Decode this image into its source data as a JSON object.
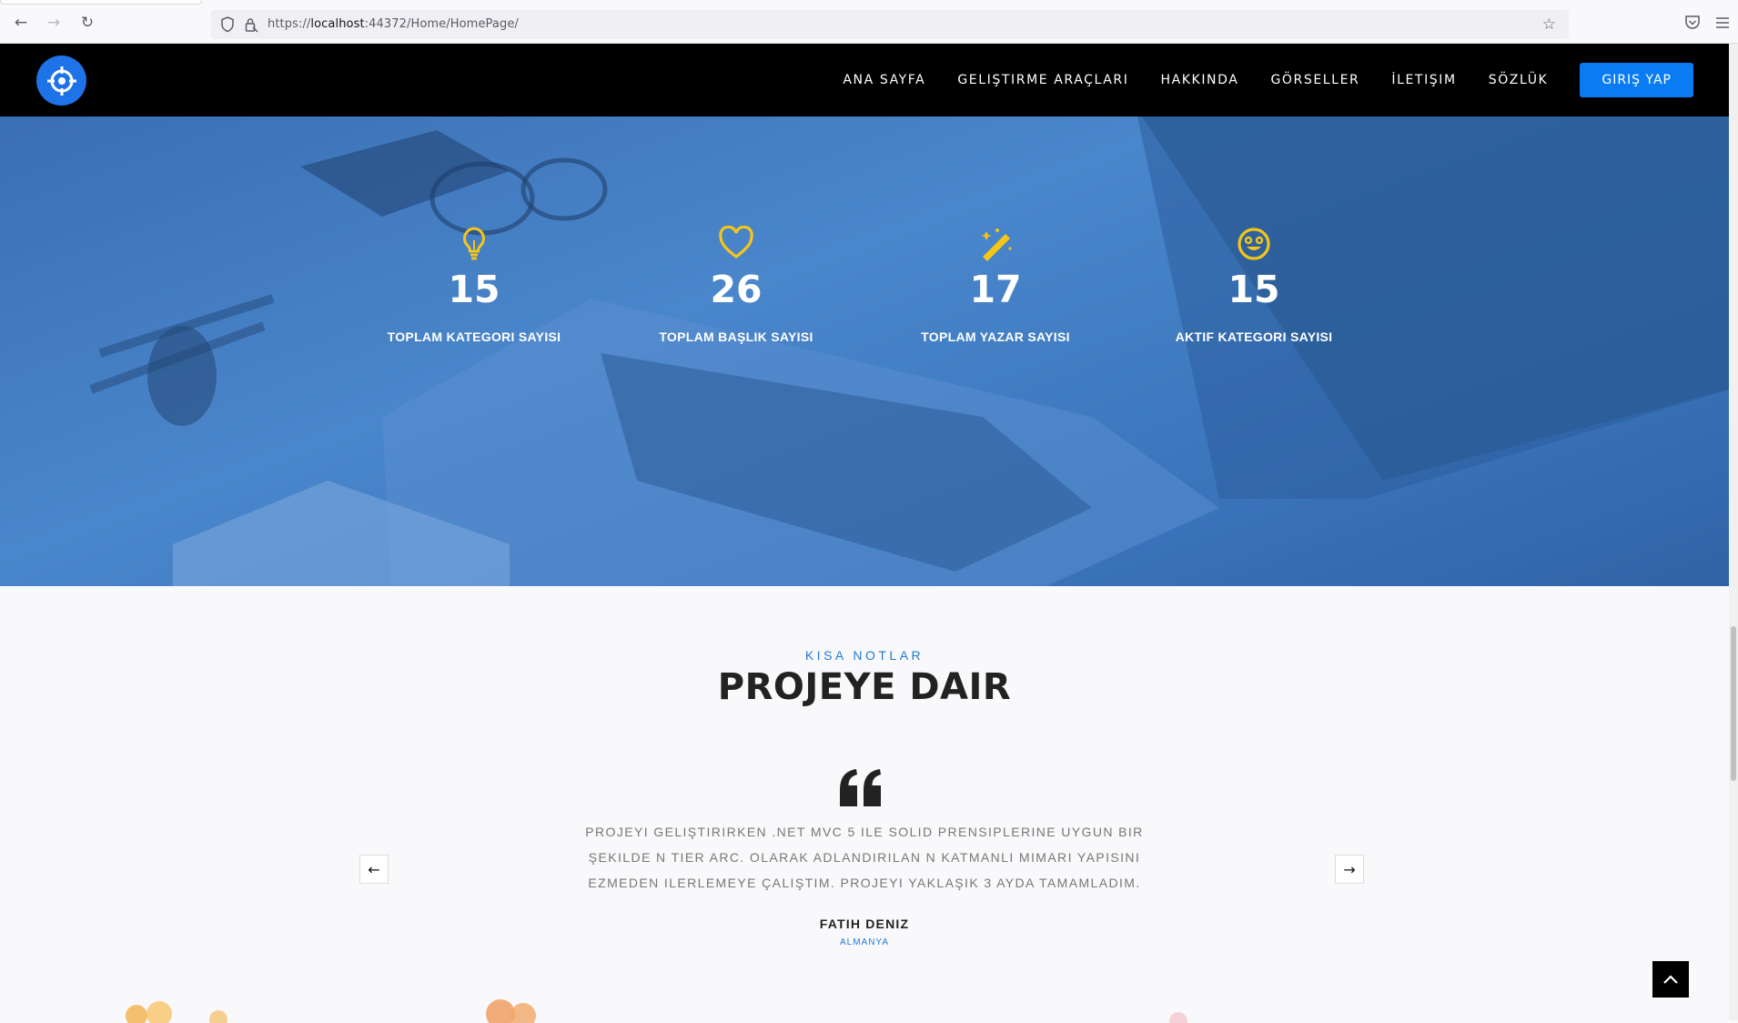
{
  "browser": {
    "url_prefix": "https://",
    "url_host": "localhost",
    "url_rest": ":44372/Home/HomePage/",
    "back_icon": "arrow-left-icon",
    "forward_icon": "arrow-right-icon",
    "reload_icon": "reload-icon"
  },
  "nav": {
    "items": [
      {
        "label": "ANA SAYFA"
      },
      {
        "label": "GELIŞTIRME ARAÇLARI"
      },
      {
        "label": "HAKKINDA"
      },
      {
        "label": "GÖRSELLER"
      },
      {
        "label": "İLETIŞIM"
      },
      {
        "label": "SÖZLÜK"
      }
    ],
    "login_label": "GIRIŞ YAP"
  },
  "stats": [
    {
      "icon": "lightbulb-icon",
      "value": "15",
      "label": "TOPLAM KATEGORI SAYISI"
    },
    {
      "icon": "heart-icon",
      "value": "26",
      "label": "TOPLAM BAŞLIK SAYISI"
    },
    {
      "icon": "magic-wand-icon",
      "value": "17",
      "label": "TOPLAM YAZAR SAYISI"
    },
    {
      "icon": "smiley-icon",
      "value": "15",
      "label": "AKTIF KATEGORI SAYISI"
    }
  ],
  "notes": {
    "subtitle": "KISA NOTLAR",
    "title": "PROJEYE DAIR",
    "quote": "PROJEYI GELIŞTIRIRKEN .NET MVC 5 ILE SOLID PRENSIPLERINE UYGUN BIR ŞEKILDE N TIER ARC. OLARAK ADLANDIRILAN N KATMANLI MIMARI YAPISINI EZMEDEN ILERLEMEYE ÇALIŞTIM. PROJEYI YAKLAŞIK 3 AYDA TAMAMLADIM.",
    "author": "FATIH DENIZ",
    "location": "ALMANYA",
    "prev_label": "←",
    "next_label": "→"
  },
  "colors": {
    "accent": "#0a7cf3",
    "icon_yellow": "#f5c518",
    "hero_blue": "#3f7cc2"
  }
}
